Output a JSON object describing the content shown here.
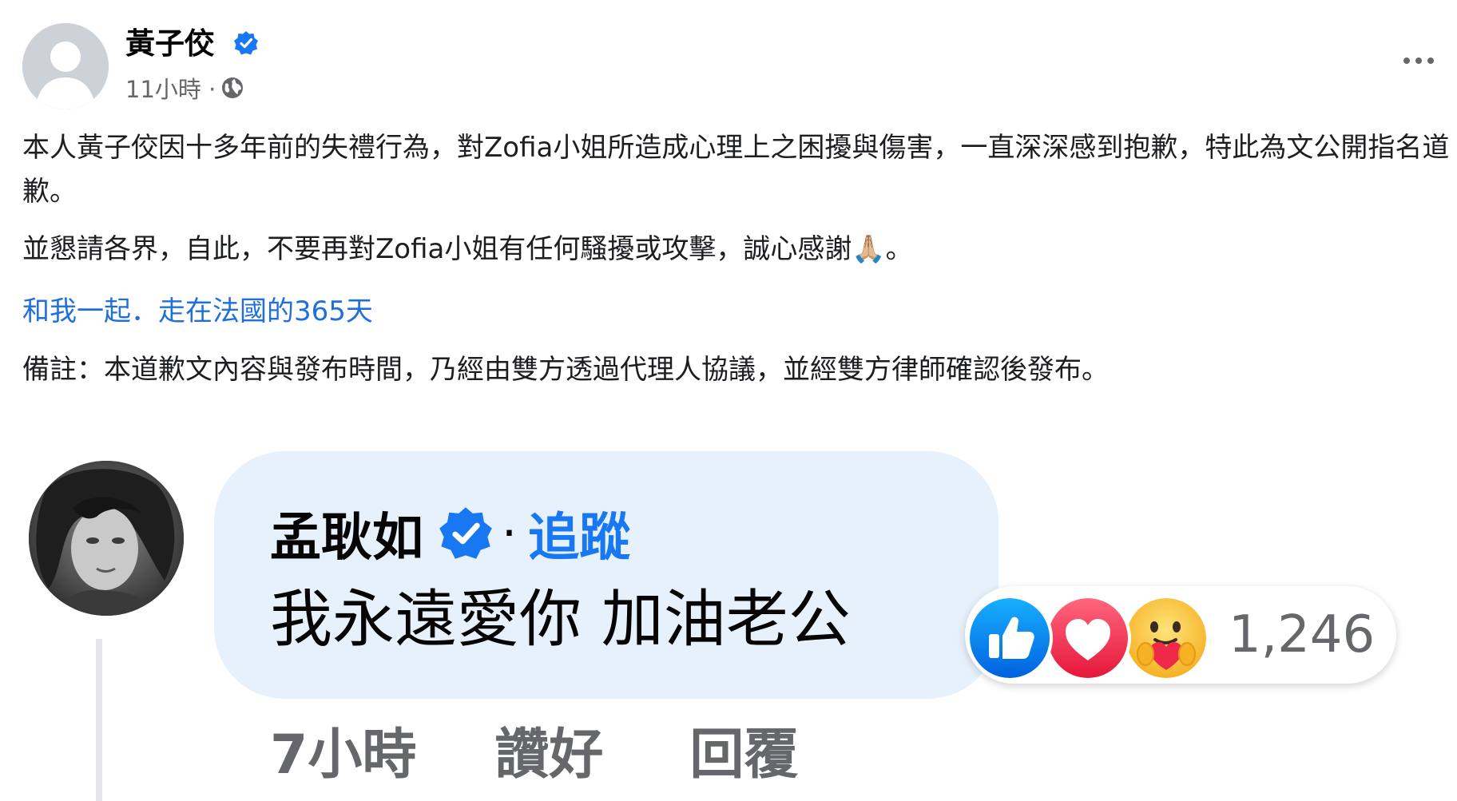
{
  "post": {
    "author": "黃子佼",
    "timestamp": "11小時 ·",
    "privacy_icon": "globe-icon",
    "more_icon": "more-horizontal-icon",
    "paragraphs": [
      "本人黃子佼因十多年前的失禮行為，對Zofia小姐所造成心理上之困擾與傷害，一直深深感到抱歉，特此為文公開指名道歉。",
      "並懇請各界，自此，不要再對Zofia小姐有任何騷擾或攻擊，誠心感謝🙏🏼。"
    ],
    "tag_link": "和我一起．走在法國的365天",
    "note": "備註：本道歉文內容與發布時間，乃經由雙方透過代理人協議，並經雙方律師確認後發布。"
  },
  "comment": {
    "author": "孟耿如",
    "separator": "·",
    "follow_label": "追蹤",
    "text": "我永遠愛你 加油老公",
    "reactions": {
      "icons": [
        "like-reaction-icon",
        "love-reaction-icon",
        "care-reaction-icon"
      ],
      "count": "1,246"
    },
    "time": "7小時",
    "like_label": "讚好",
    "reply_label": "回覆"
  },
  "colors": {
    "link_blue": "#216fdb",
    "follow_blue": "#1877f2",
    "bubble_bg": "#e7f1fc",
    "secondary_text": "#65676b",
    "verified_blue": "#1877f2"
  }
}
